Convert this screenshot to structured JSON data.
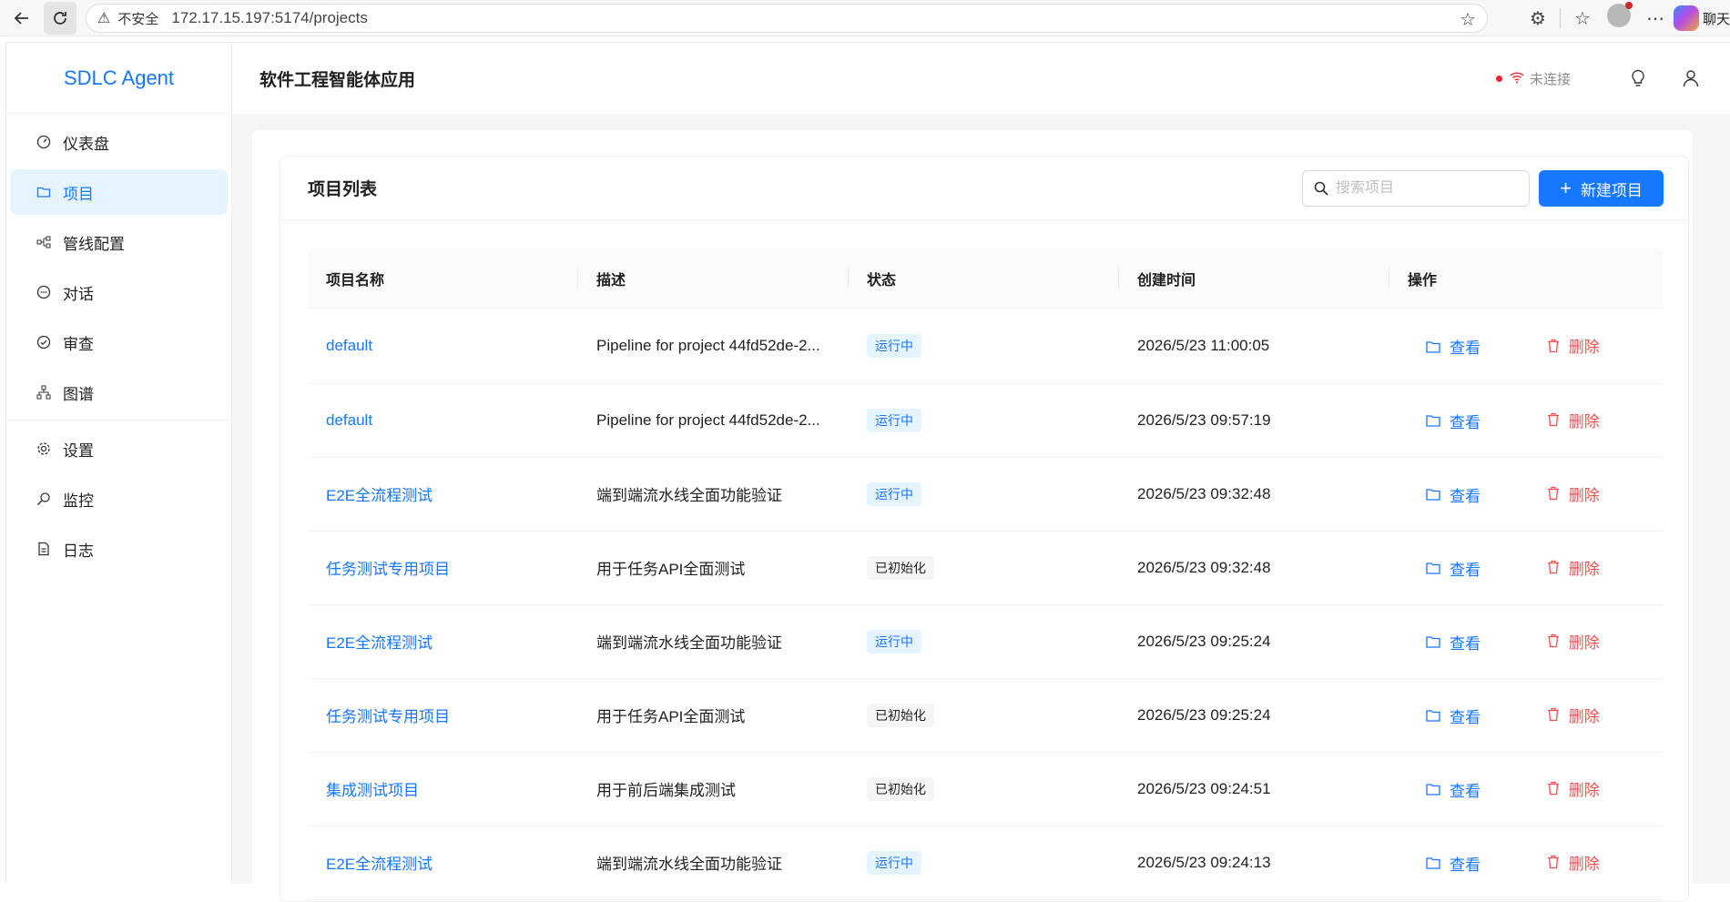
{
  "browser": {
    "insecure_label": "不安全",
    "url": "172.17.15.197:5174/projects",
    "copilot_label": "聊天"
  },
  "app": {
    "logo": "SDLC Agent",
    "header_title": "软件工程智能体应用",
    "connection_status": "未连接"
  },
  "sidebar": {
    "items": [
      {
        "label": "仪表盘",
        "icon": "dashboard-icon"
      },
      {
        "label": "项目",
        "icon": "folder-icon",
        "active": true
      },
      {
        "label": "管线配置",
        "icon": "pipeline-icon"
      },
      {
        "label": "对话",
        "icon": "chat-icon"
      },
      {
        "label": "审查",
        "icon": "check-circle-icon"
      },
      {
        "label": "图谱",
        "icon": "graph-icon"
      },
      {
        "label": "设置",
        "icon": "gear-icon"
      },
      {
        "label": "监控",
        "icon": "monitor-icon"
      },
      {
        "label": "日志",
        "icon": "log-icon"
      }
    ]
  },
  "card": {
    "title": "项目列表",
    "search_placeholder": "搜索项目",
    "new_button": "新建项目"
  },
  "table": {
    "columns": [
      "项目名称",
      "描述",
      "状态",
      "创建时间",
      "操作"
    ],
    "actions": {
      "view": "查看",
      "delete": "删除"
    },
    "rows": [
      {
        "name": "default",
        "desc": "Pipeline for project 44fd52de-2...",
        "status": "运行中",
        "status_type": "running",
        "created": "2026/5/23 11:00:05"
      },
      {
        "name": "default",
        "desc": "Pipeline for project 44fd52de-2...",
        "status": "运行中",
        "status_type": "running",
        "created": "2026/5/23 09:57:19"
      },
      {
        "name": "E2E全流程测试",
        "desc": "端到端流水线全面功能验证",
        "status": "运行中",
        "status_type": "running",
        "created": "2026/5/23 09:32:48"
      },
      {
        "name": "任务测试专用项目",
        "desc": "用于任务API全面测试",
        "status": "已初始化",
        "status_type": "initialized",
        "created": "2026/5/23 09:32:48"
      },
      {
        "name": "E2E全流程测试",
        "desc": "端到端流水线全面功能验证",
        "status": "运行中",
        "status_type": "running",
        "created": "2026/5/23 09:25:24"
      },
      {
        "name": "任务测试专用项目",
        "desc": "用于任务API全面测试",
        "status": "已初始化",
        "status_type": "initialized",
        "created": "2026/5/23 09:25:24"
      },
      {
        "name": "集成测试项目",
        "desc": "用于前后端集成测试",
        "status": "已初始化",
        "status_type": "initialized",
        "created": "2026/5/23 09:24:51"
      },
      {
        "name": "E2E全流程测试",
        "desc": "端到端流水线全面功能验证",
        "status": "运行中",
        "status_type": "running",
        "created": "2026/5/23 09:24:13"
      }
    ]
  },
  "colors": {
    "primary": "#1677ff",
    "danger": "#ff4d4f",
    "running_tag_bg": "#e6f4ff",
    "init_tag_bg": "#f5f5f5"
  }
}
